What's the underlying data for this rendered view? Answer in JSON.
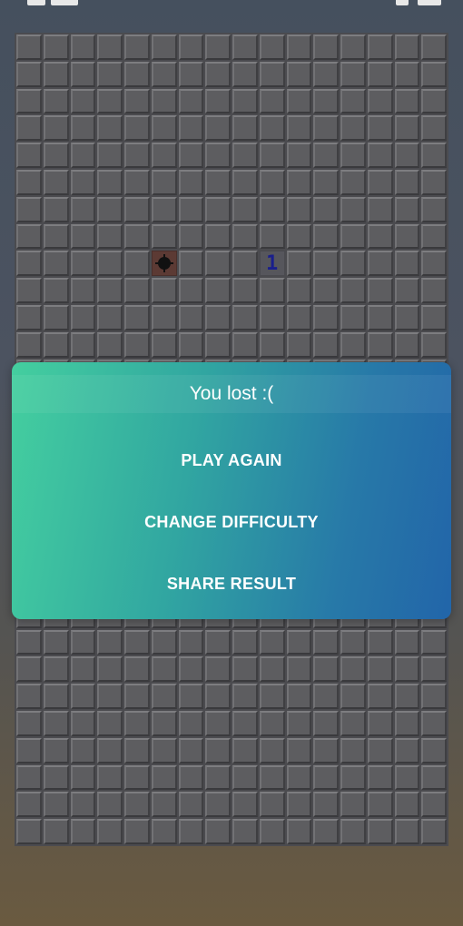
{
  "game": {
    "board": {
      "columns": 16,
      "rows": 30,
      "revealed": [
        {
          "row": 8,
          "col": 5,
          "content": "mine"
        },
        {
          "row": 8,
          "col": 9,
          "content": "number",
          "value": "1"
        }
      ]
    }
  },
  "dialog": {
    "title": "You lost :(",
    "play_again_label": "PLAY AGAIN",
    "change_difficulty_label": "CHANGE DIFFICULTY",
    "share_result_label": "SHARE RESULT"
  },
  "colors": {
    "dialog_gradient_start": "#44cf9f",
    "dialog_gradient_end": "#2265a9",
    "cell_unrevealed": "#5d5d60",
    "number_1": "#1a1f8c"
  }
}
